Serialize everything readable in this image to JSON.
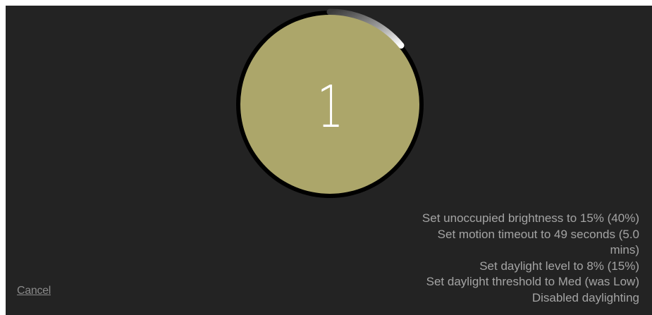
{
  "countdown": {
    "value": "1",
    "progress": 0.14,
    "fill_color": "#aca66a",
    "ring_color": "#000000",
    "arc_color": "#ffffff"
  },
  "changes": [
    "Set unoccupied brightness to 15% (40%)",
    "Set motion timeout to 49 seconds (5.0",
    "mins)",
    "Set daylight level to 8% (15%)",
    "Set daylight threshold to Med (was Low)",
    "Disabled daylighting"
  ],
  "cancel_label": "Cancel",
  "colors": {
    "background": "#232323",
    "text": "#a4a4a4"
  }
}
